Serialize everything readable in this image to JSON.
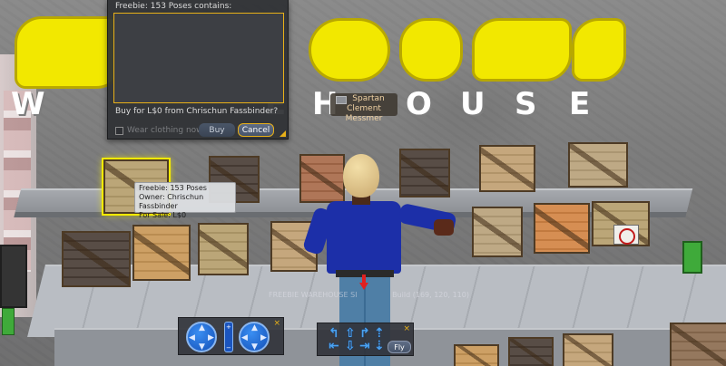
{
  "buy_dialog": {
    "title": "Freebie: 153 Poses contains:",
    "contents": "",
    "prompt": "Buy for L$0 from Chrischun Fassbinder?",
    "checkbox_label": "Wear clothing now",
    "buy_label": "Buy",
    "cancel_label": "Cancel"
  },
  "name_tag": {
    "first": "Spartan",
    "last": "Clement Messmer"
  },
  "hover_tip": {
    "line1": "Freebie: 153 Poses",
    "line2": "Owner: Chrischun Fassbinder",
    "line3": "For Sale: L$0"
  },
  "ground_text": "FREEBIE WAREHOUSE SI",
  "ground_text2": "Build (169, 120, 110)",
  "camera_controls": {
    "close": "×",
    "zoom_plus": "+",
    "zoom_minus": "−"
  },
  "move_controls": {
    "close": "×",
    "fly_label": "Fly"
  },
  "colors": {
    "accent": "#e8b018",
    "shirt": "#1c2fa8",
    "sign_yellow": "#f2e800"
  },
  "icons": [
    "avatar-icon",
    "orbit-control-icon",
    "pan-control-icon",
    "zoom-control-icon",
    "move-arrows-icon",
    "down-arrow-icon",
    "close-icon"
  ]
}
